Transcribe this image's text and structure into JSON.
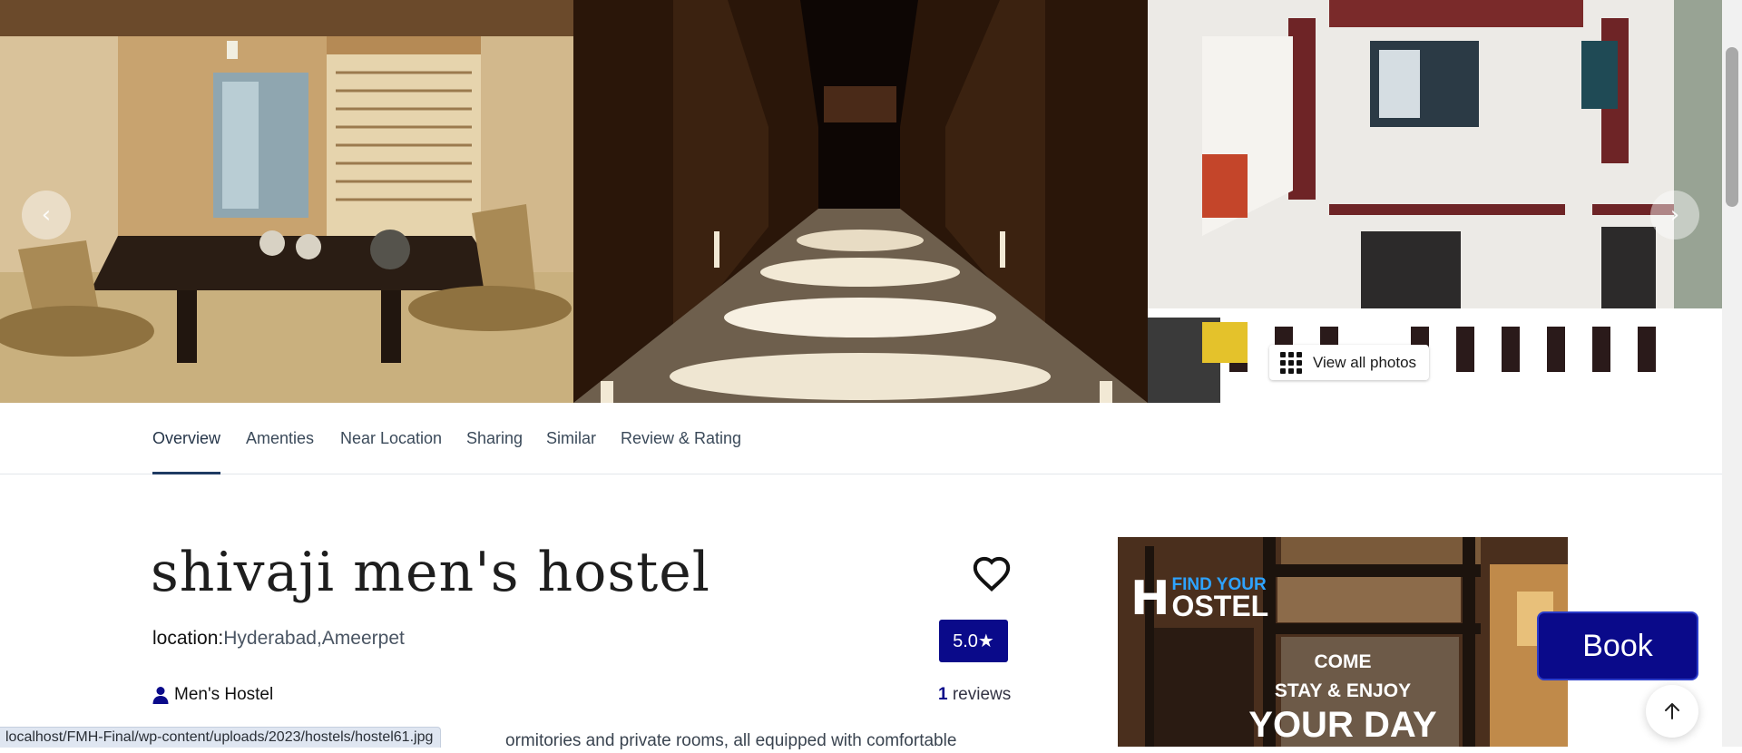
{
  "gallery": {
    "photos": [
      "tatami-room-photo",
      "hallway-photo",
      "hostel-building-photo"
    ],
    "prev_icon": "chevron-left-icon",
    "next_icon": "chevron-right-icon",
    "view_all_label": "View all photos",
    "view_all_icon": "grid-icon"
  },
  "tabs": [
    {
      "label": "Overview",
      "active": true
    },
    {
      "label": "Amenties",
      "active": false
    },
    {
      "label": "Near Location",
      "active": false
    },
    {
      "label": "Sharing",
      "active": false
    },
    {
      "label": "Similar",
      "active": false
    },
    {
      "label": "Review & Rating",
      "active": false
    }
  ],
  "hostel": {
    "name": "shivaji men's hostel",
    "location_label": "location:",
    "location_value": "Hyderabad,Ameerpet",
    "rating": "5.0★",
    "type": "Men's Hostel",
    "review_count": "1",
    "review_label": " reviews",
    "description_visible": "ormitories and private rooms, all equipped with comfortable"
  },
  "ad": {
    "logo_h": "H",
    "logo_find": "FIND YOUR",
    "logo_ostel": "OSTEL",
    "line1": "COME",
    "line2": "STAY & ENJOY",
    "line3": "YOUR DAY"
  },
  "book_label": "Book",
  "status_url": "localhost/FMH-Final/wp-content/uploads/2023/hostels/hostel61.jpg",
  "colors": {
    "brand": "#0a0a8a",
    "tab_underline": "#1f3b63"
  }
}
